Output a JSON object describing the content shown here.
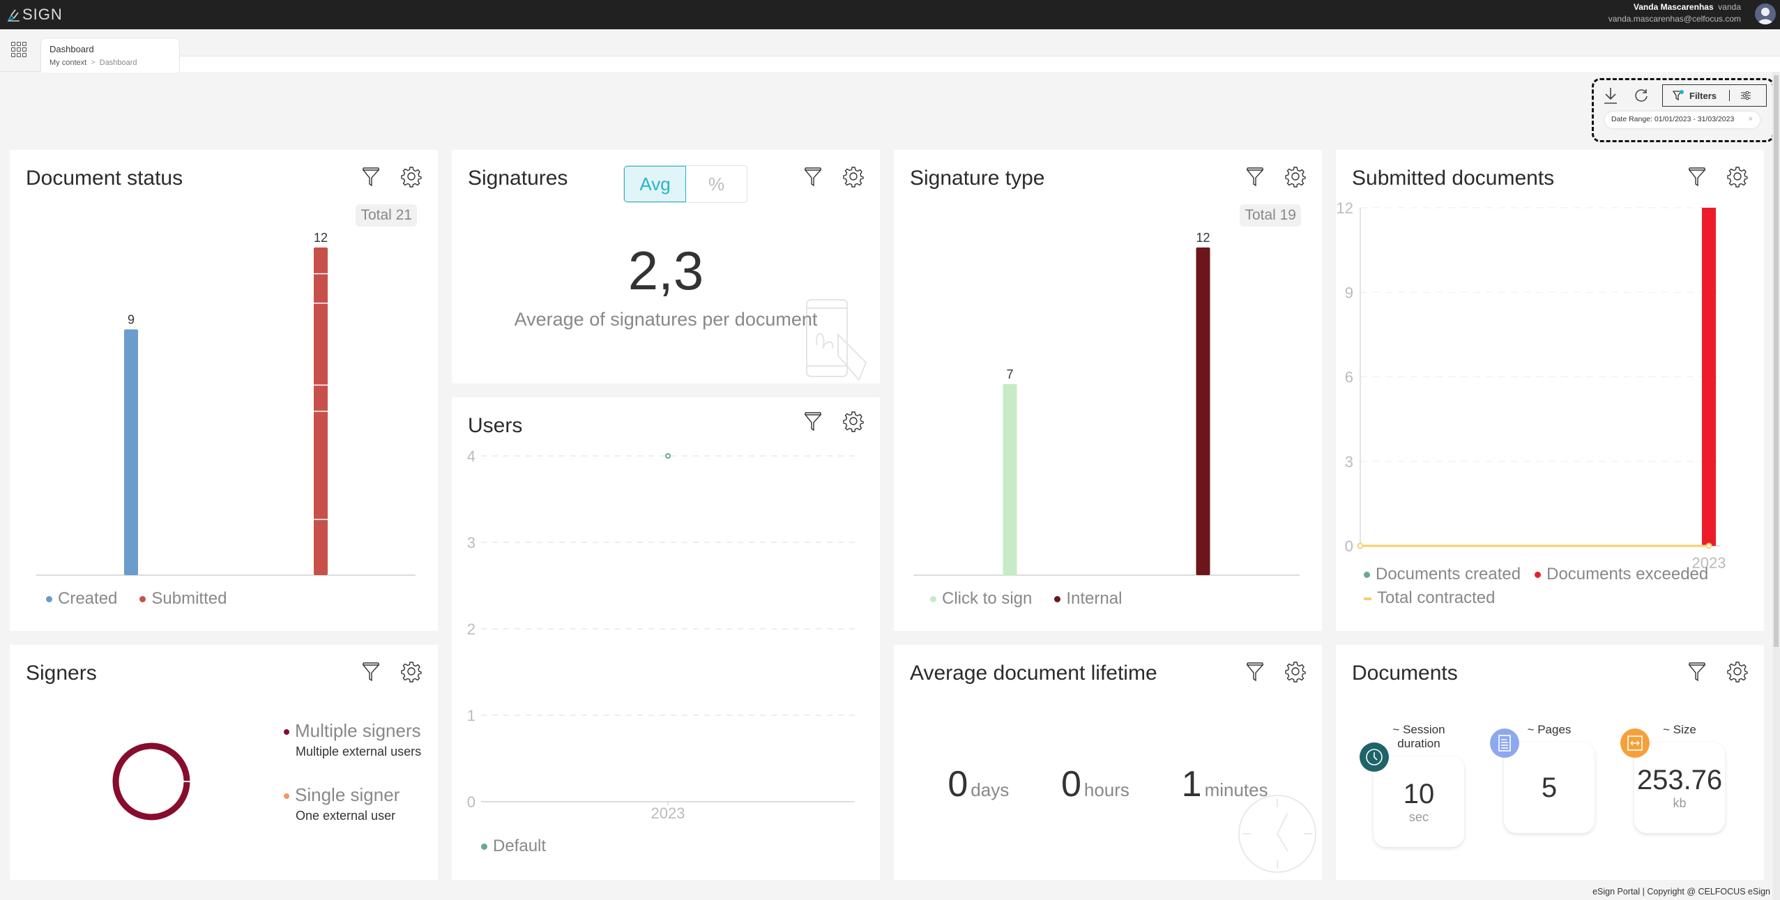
{
  "app": {
    "logo_text": "SIGN",
    "user": {
      "full_name": "Vanda Mascarenhas",
      "username": "vanda",
      "email": "vanda.mascarenhas@celfocus.com"
    }
  },
  "tabs": [
    {
      "label": "Dashboard",
      "active": true
    }
  ],
  "breadcrumb": [
    "My context",
    "Dashboard"
  ],
  "toolbar": {
    "download_icon": "download-icon",
    "refresh_icon": "refresh-icon",
    "filters_label": "Filters",
    "filters_icon": "filter-active-icon",
    "settings_icon": "sliders-icon",
    "date_chip": "Date Range: 01/01/2023 - 31/03/2023",
    "date_chip_close": "×"
  },
  "cards": {
    "document_status": {
      "title": "Document status",
      "total_label": "Total 21"
    },
    "signatures": {
      "title": "Signatures",
      "toggle": [
        {
          "label": "Avg",
          "active": true
        },
        {
          "label": "%",
          "active": false
        }
      ],
      "value": "2,3",
      "caption": "Average of signatures per document"
    },
    "signature_type": {
      "title": "Signature type",
      "total_label": "Total 19"
    },
    "submitted_documents": {
      "title": "Submitted documents"
    },
    "users": {
      "title": "Users"
    },
    "signers": {
      "title": "Signers",
      "legend": [
        {
          "name": "Multiple signers",
          "desc": "Multiple external users",
          "color": "#870c2e"
        },
        {
          "name": "Single signer",
          "desc": "One external user",
          "color": "#f4956a"
        }
      ]
    },
    "average_lifetime": {
      "title": "Average document lifetime",
      "parts": [
        {
          "value": "0",
          "unit": "days"
        },
        {
          "value": "0",
          "unit": "hours"
        },
        {
          "value": "1",
          "unit": "minutes"
        }
      ]
    },
    "documents": {
      "title": "Documents",
      "stats": [
        {
          "label": "~ Session duration",
          "value": "10",
          "unit": "sec",
          "icon": "clock-icon",
          "color": "#1e6468"
        },
        {
          "label": "~ Pages",
          "value": "5",
          "unit": "",
          "icon": "document-icon",
          "color": "#8ea8ee"
        },
        {
          "label": "~ Size",
          "value": "253.76",
          "unit": "kb",
          "icon": "resize-icon",
          "color": "#f5a03a"
        }
      ]
    }
  },
  "chart_data": [
    {
      "id": "document_status",
      "type": "bar",
      "title": "Document status",
      "categories": [
        "Created",
        "Submitted"
      ],
      "values": [
        9,
        12
      ],
      "colors": [
        "#6a9ccc",
        "#c7514a"
      ],
      "data_labels": [
        "9",
        "12"
      ],
      "ylim": [
        0,
        12
      ],
      "grid": false,
      "legend": "bottom-left"
    },
    {
      "id": "signature_type",
      "type": "bar",
      "title": "Signature type",
      "categories": [
        "Click to sign",
        "Internal"
      ],
      "values": [
        7,
        12
      ],
      "colors": [
        "#c6ebc6",
        "#6c161b"
      ],
      "data_labels": [
        "7",
        "12"
      ],
      "ylim": [
        0,
        12
      ],
      "grid": false,
      "legend": "bottom-left"
    },
    {
      "id": "submitted_documents",
      "type": "bar",
      "title": "Submitted documents",
      "x": [
        "",
        "2023"
      ],
      "series": [
        {
          "name": "Documents created",
          "kind": "bar",
          "color": "#6aa88e",
          "values": [
            0,
            0
          ]
        },
        {
          "name": "Documents exceeded",
          "kind": "bar",
          "color": "#ec1c2a",
          "values": [
            0,
            12
          ]
        },
        {
          "name": "Total contracted",
          "kind": "line",
          "color": "#f8cf6e",
          "values": [
            0,
            0
          ]
        }
      ],
      "yticks": [
        "0",
        "3",
        "6",
        "9",
        "12"
      ],
      "ylim": [
        0,
        12
      ],
      "grid": true,
      "legend": "bottom-left"
    },
    {
      "id": "users",
      "type": "line",
      "title": "Users",
      "x": [
        "2023"
      ],
      "series": [
        {
          "name": "Default",
          "color": "#6aa88e",
          "values": [
            4
          ]
        }
      ],
      "yticks": [
        "0",
        "1",
        "2",
        "3",
        "4"
      ],
      "ylim": [
        0,
        4
      ],
      "grid": true,
      "legend": "bottom-left"
    },
    {
      "id": "signers",
      "type": "pie",
      "title": "Signers",
      "categories": [
        "Multiple signers",
        "Single signer"
      ],
      "values": [
        100,
        0
      ],
      "colors": [
        "#870c2e",
        "#f4956a"
      ],
      "legend": "right"
    }
  ],
  "footer": "eSign Portal | Copyright @ CELFOCUS eSign"
}
